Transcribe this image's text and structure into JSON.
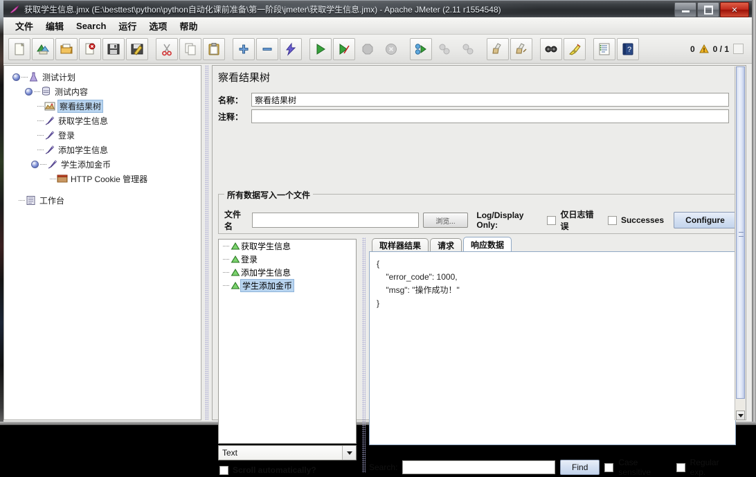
{
  "window": {
    "title": "获取学生信息.jmx (E:\\besttest\\python\\python自动化课前准备\\第一阶段\\jmeter\\获取学生信息.jmx) - Apache JMeter (2.11 r1554548)",
    "minimize_label": "—",
    "maximize_label": "□",
    "close_label": "✕"
  },
  "menubar": {
    "items": [
      {
        "label": "文件"
      },
      {
        "label": "编辑"
      },
      {
        "label": "Search"
      },
      {
        "label": "运行"
      },
      {
        "label": "选项"
      },
      {
        "label": "帮助"
      }
    ]
  },
  "toolbar": {
    "buttons": [
      {
        "name": "new-icon"
      },
      {
        "name": "templates-icon"
      },
      {
        "name": "open-icon"
      },
      {
        "name": "close-icon"
      },
      {
        "name": "save-icon"
      },
      {
        "name": "save-as-icon"
      },
      {
        "name": "cut-icon"
      },
      {
        "name": "copy-icon"
      },
      {
        "name": "paste-icon"
      },
      {
        "name": "expand-icon"
      },
      {
        "name": "collapse-icon"
      },
      {
        "name": "toggle-icon"
      },
      {
        "name": "start-icon"
      },
      {
        "name": "start-no-pauses-icon"
      },
      {
        "name": "stop-icon"
      },
      {
        "name": "shutdown-icon"
      },
      {
        "name": "start-remote-icon"
      },
      {
        "name": "stop-remote-icon"
      },
      {
        "name": "shutdown-remote-icon"
      },
      {
        "name": "clear-icon"
      },
      {
        "name": "clear-all-icon"
      },
      {
        "name": "search-icon"
      },
      {
        "name": "search-reset-icon"
      },
      {
        "name": "function-helper-icon"
      },
      {
        "name": "help-icon"
      }
    ],
    "status": {
      "warnings_count": "0",
      "threads": "0 / 1"
    }
  },
  "tree": {
    "nodes": [
      {
        "label": "测试计划",
        "icon": "test-plan-icon",
        "depth": 0,
        "expanded": true,
        "selected": false
      },
      {
        "label": "测试内容",
        "icon": "thread-group-icon",
        "depth": 1,
        "expanded": true,
        "selected": false
      },
      {
        "label": "察看结果树",
        "icon": "view-results-tree-icon",
        "depth": 2,
        "expanded": false,
        "selected": true
      },
      {
        "label": "获取学生信息",
        "icon": "http-sampler-icon",
        "depth": 2,
        "expanded": false,
        "selected": false
      },
      {
        "label": "登录",
        "icon": "http-sampler-icon",
        "depth": 2,
        "expanded": false,
        "selected": false
      },
      {
        "label": "添加学生信息",
        "icon": "http-sampler-icon",
        "depth": 2,
        "expanded": false,
        "selected": false
      },
      {
        "label": "学生添加金币",
        "icon": "http-sampler-icon",
        "depth": 2,
        "expanded": true,
        "selected": false
      },
      {
        "label": "HTTP Cookie 管理器",
        "icon": "cookie-manager-icon",
        "depth": 3,
        "expanded": false,
        "selected": false
      },
      {
        "label": "工作台",
        "icon": "workbench-icon",
        "depth": 0,
        "expanded": false,
        "selected": false
      }
    ]
  },
  "panel": {
    "title": "察看结果树",
    "name_label": "名称：",
    "name_value": "察看结果树",
    "comment_label": "注释：",
    "comment_value": "",
    "filegroup": {
      "title": "所有数据写入一个文件",
      "filename_label": "文件名",
      "filename_value": "",
      "browse_label": "浏览...",
      "logdisplay_label": "Log/Display Only:",
      "errors_only_label": "仅日志错误",
      "errors_only_checked": false,
      "successes_label": "Successes",
      "successes_checked": false,
      "configure_label": "Configure"
    },
    "results": {
      "items": [
        {
          "label": "获取学生信息",
          "status": "success",
          "selected": false
        },
        {
          "label": "登录",
          "status": "success",
          "selected": false
        },
        {
          "label": "添加学生信息",
          "status": "success",
          "selected": false
        },
        {
          "label": "学生添加金币",
          "status": "success",
          "selected": true
        }
      ],
      "renderer_selected": "Text",
      "scroll_auto_label": "Scroll automatically?",
      "scroll_auto_checked": false
    },
    "tabs": [
      {
        "label": "取样器结果",
        "active": false
      },
      {
        "label": "请求",
        "active": false
      },
      {
        "label": "响应数据",
        "active": true
      }
    ],
    "response_body": "{\n    \"error_code\": 1000,\n    \"msg\": \"操作成功！\"\n}",
    "search": {
      "label": "Search:",
      "value": "",
      "find_label": "Find",
      "case_sensitive_label": "Case sensitive",
      "case_sensitive_checked": false,
      "regex_label": "Regular exp.",
      "regex_checked": false
    }
  },
  "colors": {
    "selection": "#b8d4ef",
    "accent": "#8fa8c4",
    "success": "#3f8f34",
    "warning": "#f0b323",
    "close": "#c02a1c"
  }
}
